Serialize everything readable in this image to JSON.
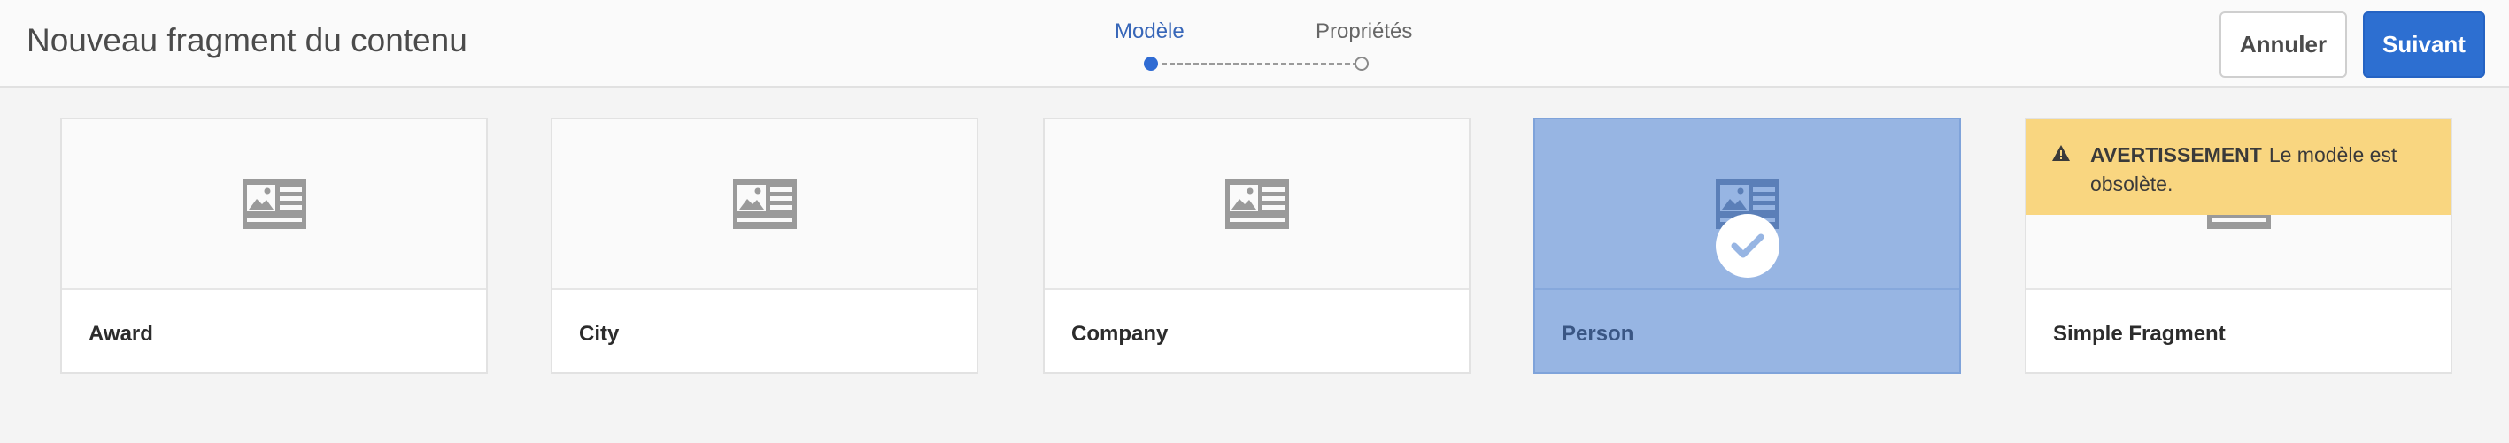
{
  "header": {
    "title": "Nouveau fragment du contenu",
    "steps": [
      {
        "label": "Modèle",
        "state": "active"
      },
      {
        "label": "Propriétés",
        "state": "inactive"
      }
    ],
    "cancel_label": "Annuler",
    "next_label": "Suivant"
  },
  "models": [
    {
      "label": "Award",
      "selected": false
    },
    {
      "label": "City",
      "selected": false
    },
    {
      "label": "Company",
      "selected": false
    },
    {
      "label": "Person",
      "selected": true
    },
    {
      "label": "Simple Fragment",
      "selected": false
    }
  ],
  "warning": {
    "title": "AVERTISSEMENT",
    "text": "Le modèle est obsolète."
  },
  "colors": {
    "accent": "#2d6fd1",
    "selected": "#97b5e3",
    "warning": "#f9d680"
  },
  "icons": {
    "model": "image-text-icon",
    "check": "checkmark-icon",
    "alert": "alert-triangle-icon"
  }
}
